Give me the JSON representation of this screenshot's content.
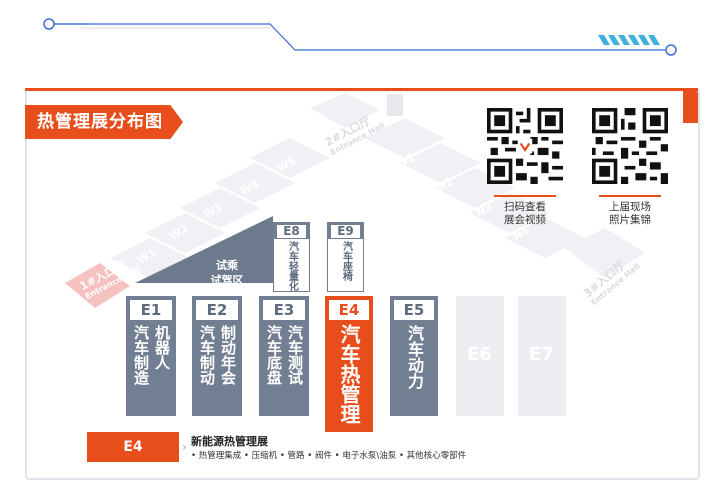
{
  "title": "热管理展分布图",
  "qr_codes": [
    {
      "line1": "扫码查看",
      "line2": "展会视频"
    },
    {
      "line1": "上届现场",
      "line2": "照片集锦"
    }
  ],
  "entrances": {
    "e1_num": "1#",
    "e1_cn": "入口厅",
    "e1_en": "Entrance Hall",
    "e2_num": "2#",
    "e2_cn": "入口厅",
    "e2_en": "Entrance Hall",
    "e3_num": "3#",
    "e3_cn": "入口厅",
    "e3_en": "Entrance Hall"
  },
  "west_halls": [
    "W1",
    "W2",
    "W3",
    "W4",
    "W5"
  ],
  "north_halls": [
    "N1",
    "N2",
    "N3",
    "N4",
    "N5"
  ],
  "ride_area": {
    "line1": "试乘",
    "line2": "试驾区"
  },
  "small_halls": [
    {
      "code": "E8",
      "name": "汽车轻量化"
    },
    {
      "code": "E9",
      "name": "汽车座椅"
    }
  ],
  "halls": [
    {
      "code": "E1",
      "col1": "汽车制造",
      "col2": "机器人"
    },
    {
      "code": "E2",
      "col1": "汽车制动",
      "col2": "制动年会"
    },
    {
      "code": "E3",
      "col1": "汽车底盘",
      "col2": "汽车测试"
    },
    {
      "code": "E4",
      "name": "汽车热管理"
    },
    {
      "code": "E5",
      "name": "汽车动力"
    }
  ],
  "ghost_halls": [
    "E6",
    "E7"
  ],
  "legend": {
    "code": "E4",
    "title": "新能源热管理展",
    "items": "• 热管理集成  • 压缩机  • 管路  • 阀件  • 电子水泵\\油泵  • 其他核心零部件"
  },
  "colors": {
    "accent": "#e84e1b",
    "hall": "#727f92",
    "line": "#3b6fd4"
  }
}
